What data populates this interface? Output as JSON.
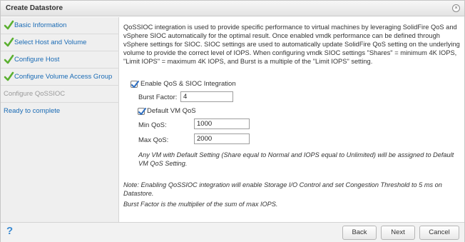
{
  "dialog": {
    "title": "Create Datastore",
    "close_glyph": "×"
  },
  "sidebar": {
    "steps": [
      {
        "label": "Basic Information",
        "state": "completed"
      },
      {
        "label": "Select Host and Volume",
        "state": "completed"
      },
      {
        "label": "Configure Host",
        "state": "completed"
      },
      {
        "label": "Configure Volume Access Group",
        "state": "completed"
      },
      {
        "label": "Configure QoSSIOC",
        "state": "current"
      },
      {
        "label": "Ready to complete",
        "state": "pending"
      }
    ]
  },
  "content": {
    "description": "QoSSIOC integration is used to provide specific performance to virtual machines by leveraging SolidFire QoS and vSphere SIOC automatically for the optimal result. Once enabled vmdk performance can be defined through vSphere settings for SIOC. SIOC settings are used to automatically update SolidFire QoS setting on the underlying volume to provide the correct level of IOPS. When configuring vmdk SIOC settings \"Shares\" = minimum 4K IOPS, \"Limit IOPS\" = maximum 4K IOPS, and Burst is a multiple of the \"Limit IOPS\" setting.",
    "enable_qos": {
      "label": "Enable QoS & SIOC Integration",
      "checked": true
    },
    "burst_factor": {
      "label": "Burst Factor:",
      "value": "4"
    },
    "default_vm_qos": {
      "label": "Default VM QoS",
      "checked": true
    },
    "min_qos": {
      "label": "Min QoS:",
      "value": "1000"
    },
    "max_qos": {
      "label": "Max QoS:",
      "value": "2000"
    },
    "default_note": "Any VM with Default Setting (Share equal to Normal and IOPS equal to Unlimited) will be assigned to Default VM QoS Setting.",
    "note_sioc": "Note: Enabling  QoSSIOC integration will enable Storage I/O Control and set Congestion Threshold to 5 ms on Datastore.",
    "note_burst": "Burst Factor is the multiplier of the sum of max IOPS."
  },
  "footer": {
    "help_glyph": "?",
    "back_label": "Back",
    "next_label": "Next",
    "cancel_label": "Cancel"
  },
  "colors": {
    "link_blue": "#1a6bb5",
    "check_green": "#5bb030",
    "help_blue": "#3a8ad1"
  }
}
